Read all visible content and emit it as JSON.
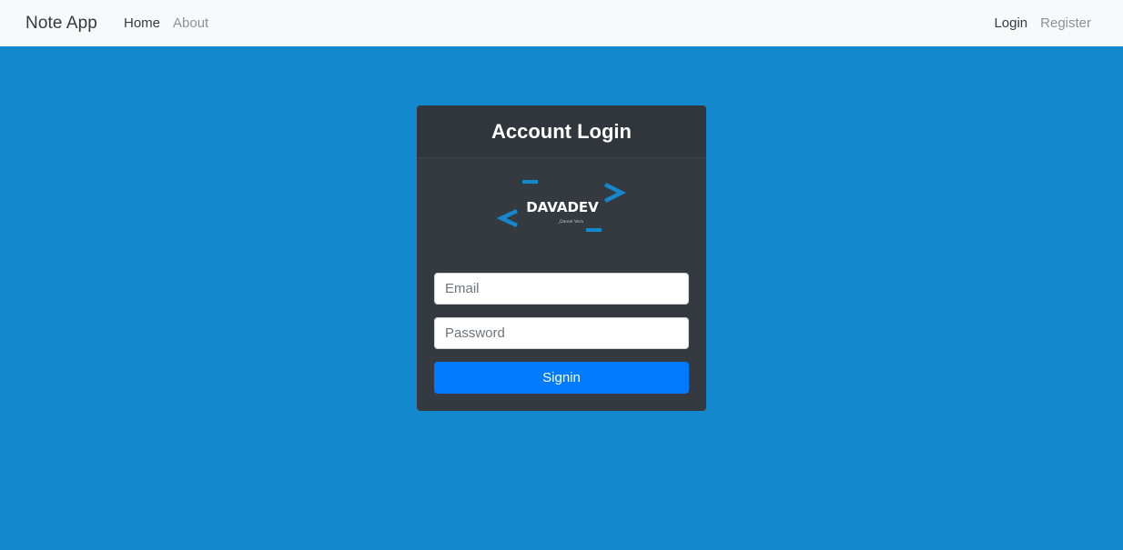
{
  "navbar": {
    "brand": "Note App",
    "left_links": [
      {
        "label": "Home"
      },
      {
        "label": "About"
      }
    ],
    "right_links": [
      {
        "label": "Login"
      },
      {
        "label": "Register"
      }
    ]
  },
  "login_card": {
    "title": "Account Login",
    "logo": {
      "text": "DAVADEV",
      "subtext": "_Daniel Vera",
      "accent_color": "#1488cc"
    },
    "email": {
      "placeholder": "Email",
      "value": ""
    },
    "password": {
      "placeholder": "Password",
      "value": ""
    },
    "submit_label": "Signin"
  },
  "colors": {
    "page_background": "#1488cc",
    "navbar_background": "#f8f9fa",
    "card_background": "#343a40",
    "button_primary": "#007bff"
  }
}
